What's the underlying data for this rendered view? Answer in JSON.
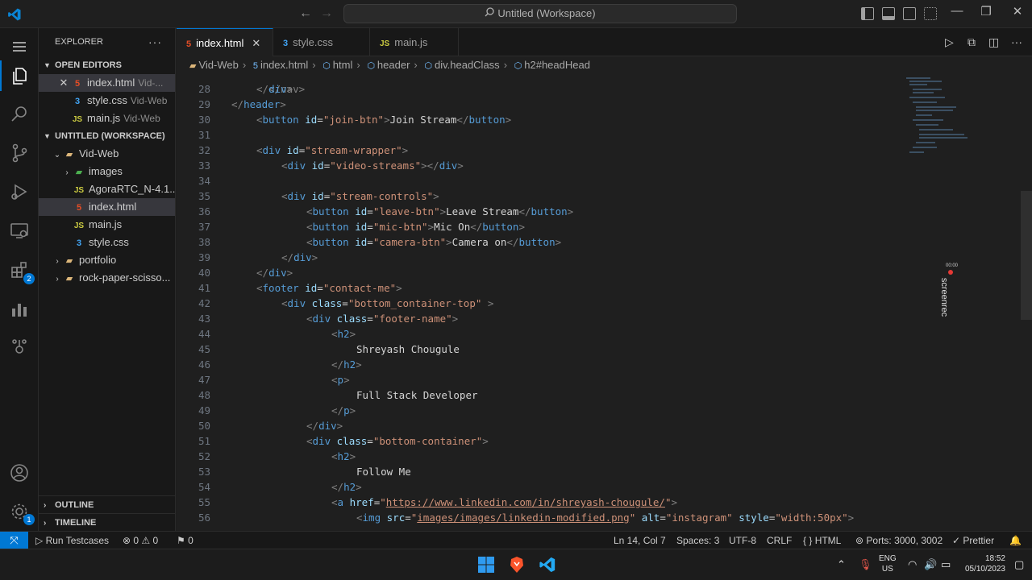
{
  "titlebar": {
    "search_text": "Untitled (Workspace)",
    "nav_back": "←",
    "nav_forward": "→",
    "minimize": "—",
    "restore": "❐",
    "close": "✕"
  },
  "sidebar": {
    "title": "EXPLORER",
    "more": "···",
    "open_editors_title": "OPEN EDITORS",
    "open_editors": [
      {
        "icon": "5",
        "name": "index.html",
        "desc": "Vid-...",
        "type": "html"
      },
      {
        "icon": "3",
        "name": "style.css",
        "desc": "Vid-Web",
        "type": "css"
      },
      {
        "icon": "JS",
        "name": "main.js",
        "desc": "Vid-Web",
        "type": "js"
      }
    ],
    "workspace_title": "UNTITLED (WORKSPACE)",
    "tree": [
      {
        "chev": "⌄",
        "icon": "▰",
        "name": "Vid-Web",
        "type": "folder",
        "indent": 16
      },
      {
        "chev": "›",
        "icon": "▰",
        "name": "images",
        "type": "img",
        "indent": 28
      },
      {
        "chev": "",
        "icon": "JS",
        "name": "AgoraRTC_N-4.1....",
        "type": "js",
        "indent": 28
      },
      {
        "chev": "",
        "icon": "5",
        "name": "index.html",
        "type": "html",
        "indent": 28
      },
      {
        "chev": "",
        "icon": "JS",
        "name": "main.js",
        "type": "js",
        "indent": 28
      },
      {
        "chev": "",
        "icon": "3",
        "name": "style.css",
        "type": "css",
        "indent": 28
      },
      {
        "chev": "›",
        "icon": "▰",
        "name": "portfolio",
        "type": "folder",
        "indent": 16
      },
      {
        "chev": "›",
        "icon": "▰",
        "name": "rock-paper-scisso...",
        "type": "folder",
        "indent": 16
      }
    ],
    "outline_title": "OUTLINE",
    "timeline_title": "TIMELINE"
  },
  "tabs": [
    {
      "icon": "5",
      "name": "index.html",
      "type": "html",
      "close": "✕"
    },
    {
      "icon": "3",
      "name": "style.css",
      "type": "css"
    },
    {
      "icon": "JS",
      "name": "main.js",
      "type": "js"
    }
  ],
  "breadcrumb": {
    "items": [
      "Vid-Web",
      "index.html",
      "html",
      "header",
      "div.headClass",
      "h2#headHead"
    ]
  },
  "editor": {
    "partial_top": "</nav>",
    "lines": [
      {
        "n": 28,
        "indent": 1,
        "parts": [
          [
            "p",
            "</"
          ],
          [
            "t",
            "div"
          ],
          [
            "p",
            ">"
          ]
        ]
      },
      {
        "n": 29,
        "indent": 0,
        "parts": [
          [
            "p",
            "</"
          ],
          [
            "t",
            "header"
          ],
          [
            "p",
            ">"
          ]
        ]
      },
      {
        "n": 30,
        "indent": 1,
        "parts": [
          [
            "p",
            "<"
          ],
          [
            "t",
            "button"
          ],
          [
            "x",
            " "
          ],
          [
            "a",
            "id"
          ],
          [
            "x",
            "="
          ],
          [
            "s",
            "\"join-btn\""
          ],
          [
            "p",
            ">"
          ],
          [
            "x",
            "Join Stream"
          ],
          [
            "p",
            "</"
          ],
          [
            "t",
            "button"
          ],
          [
            "p",
            ">"
          ]
        ]
      },
      {
        "n": 31,
        "indent": 0,
        "parts": []
      },
      {
        "n": 32,
        "indent": 1,
        "parts": [
          [
            "p",
            "<"
          ],
          [
            "t",
            "div"
          ],
          [
            "x",
            " "
          ],
          [
            "a",
            "id"
          ],
          [
            "x",
            "="
          ],
          [
            "s",
            "\"stream-wrapper\""
          ],
          [
            "p",
            ">"
          ]
        ]
      },
      {
        "n": 33,
        "indent": 2,
        "parts": [
          [
            "p",
            "<"
          ],
          [
            "t",
            "div"
          ],
          [
            "x",
            " "
          ],
          [
            "a",
            "id"
          ],
          [
            "x",
            "="
          ],
          [
            "s",
            "\"video-streams\""
          ],
          [
            "p",
            "></"
          ],
          [
            "t",
            "div"
          ],
          [
            "p",
            ">"
          ]
        ]
      },
      {
        "n": 34,
        "indent": 0,
        "parts": []
      },
      {
        "n": 35,
        "indent": 2,
        "parts": [
          [
            "p",
            "<"
          ],
          [
            "t",
            "div"
          ],
          [
            "x",
            " "
          ],
          [
            "a",
            "id"
          ],
          [
            "x",
            "="
          ],
          [
            "s",
            "\"stream-controls\""
          ],
          [
            "p",
            ">"
          ]
        ]
      },
      {
        "n": 36,
        "indent": 3,
        "parts": [
          [
            "p",
            "<"
          ],
          [
            "t",
            "button"
          ],
          [
            "x",
            " "
          ],
          [
            "a",
            "id"
          ],
          [
            "x",
            "="
          ],
          [
            "s",
            "\"leave-btn\""
          ],
          [
            "p",
            ">"
          ],
          [
            "x",
            "Leave Stream"
          ],
          [
            "p",
            "</"
          ],
          [
            "t",
            "button"
          ],
          [
            "p",
            ">"
          ]
        ]
      },
      {
        "n": 37,
        "indent": 3,
        "parts": [
          [
            "p",
            "<"
          ],
          [
            "t",
            "button"
          ],
          [
            "x",
            " "
          ],
          [
            "a",
            "id"
          ],
          [
            "x",
            "="
          ],
          [
            "s",
            "\"mic-btn\""
          ],
          [
            "p",
            ">"
          ],
          [
            "x",
            "Mic On"
          ],
          [
            "p",
            "</"
          ],
          [
            "t",
            "button"
          ],
          [
            "p",
            ">"
          ]
        ]
      },
      {
        "n": 38,
        "indent": 3,
        "parts": [
          [
            "p",
            "<"
          ],
          [
            "t",
            "button"
          ],
          [
            "x",
            " "
          ],
          [
            "a",
            "id"
          ],
          [
            "x",
            "="
          ],
          [
            "s",
            "\"camera-btn\""
          ],
          [
            "p",
            ">"
          ],
          [
            "x",
            "Camera on"
          ],
          [
            "p",
            "</"
          ],
          [
            "t",
            "button"
          ],
          [
            "p",
            ">"
          ]
        ]
      },
      {
        "n": 39,
        "indent": 2,
        "parts": [
          [
            "p",
            "</"
          ],
          [
            "t",
            "div"
          ],
          [
            "p",
            ">"
          ]
        ]
      },
      {
        "n": 40,
        "indent": 1,
        "parts": [
          [
            "p",
            "</"
          ],
          [
            "t",
            "div"
          ],
          [
            "p",
            ">"
          ]
        ]
      },
      {
        "n": 41,
        "indent": 1,
        "parts": [
          [
            "p",
            "<"
          ],
          [
            "t",
            "footer"
          ],
          [
            "x",
            " "
          ],
          [
            "a",
            "id"
          ],
          [
            "x",
            "="
          ],
          [
            "s",
            "\"contact-me\""
          ],
          [
            "p",
            ">"
          ]
        ]
      },
      {
        "n": 42,
        "indent": 2,
        "parts": [
          [
            "p",
            "<"
          ],
          [
            "t",
            "div"
          ],
          [
            "x",
            " "
          ],
          [
            "a",
            "class"
          ],
          [
            "x",
            "="
          ],
          [
            "s",
            "\"bottom_container-top\""
          ],
          [
            "x",
            " "
          ],
          [
            "p",
            ">"
          ]
        ]
      },
      {
        "n": 43,
        "indent": 3,
        "parts": [
          [
            "p",
            "<"
          ],
          [
            "t",
            "div"
          ],
          [
            "x",
            " "
          ],
          [
            "a",
            "class"
          ],
          [
            "x",
            "="
          ],
          [
            "s",
            "\"footer-name\""
          ],
          [
            "p",
            ">"
          ]
        ]
      },
      {
        "n": 44,
        "indent": 4,
        "parts": [
          [
            "p",
            "<"
          ],
          [
            "t",
            "h2"
          ],
          [
            "p",
            ">"
          ]
        ]
      },
      {
        "n": 45,
        "indent": 5,
        "parts": [
          [
            "x",
            "Shreyash Chougule"
          ]
        ]
      },
      {
        "n": 46,
        "indent": 4,
        "parts": [
          [
            "p",
            "</"
          ],
          [
            "t",
            "h2"
          ],
          [
            "p",
            ">"
          ]
        ]
      },
      {
        "n": 47,
        "indent": 4,
        "parts": [
          [
            "p",
            "<"
          ],
          [
            "t",
            "p"
          ],
          [
            "p",
            ">"
          ]
        ]
      },
      {
        "n": 48,
        "indent": 5,
        "parts": [
          [
            "x",
            "Full Stack Developer"
          ]
        ]
      },
      {
        "n": 49,
        "indent": 4,
        "parts": [
          [
            "p",
            "</"
          ],
          [
            "t",
            "p"
          ],
          [
            "p",
            ">"
          ]
        ]
      },
      {
        "n": 50,
        "indent": 3,
        "parts": [
          [
            "p",
            "</"
          ],
          [
            "t",
            "div"
          ],
          [
            "p",
            ">"
          ]
        ]
      },
      {
        "n": 51,
        "indent": 3,
        "parts": [
          [
            "p",
            "<"
          ],
          [
            "t",
            "div"
          ],
          [
            "x",
            " "
          ],
          [
            "a",
            "class"
          ],
          [
            "x",
            "="
          ],
          [
            "s",
            "\"bottom-container\""
          ],
          [
            "p",
            ">"
          ]
        ]
      },
      {
        "n": 52,
        "indent": 4,
        "parts": [
          [
            "p",
            "<"
          ],
          [
            "t",
            "h2"
          ],
          [
            "p",
            ">"
          ]
        ]
      },
      {
        "n": 53,
        "indent": 5,
        "parts": [
          [
            "x",
            "Follow Me"
          ]
        ]
      },
      {
        "n": 54,
        "indent": 4,
        "parts": [
          [
            "p",
            "</"
          ],
          [
            "t",
            "h2"
          ],
          [
            "p",
            ">"
          ]
        ]
      },
      {
        "n": 55,
        "indent": 4,
        "parts": [
          [
            "p",
            "<"
          ],
          [
            "t",
            "a"
          ],
          [
            "x",
            " "
          ],
          [
            "a",
            "href"
          ],
          [
            "x",
            "="
          ],
          [
            "s",
            "\""
          ],
          [
            "l",
            "https://www.linkedin.com/in/shreyash-chougule/"
          ],
          [
            "s",
            "\""
          ],
          [
            "p",
            ">"
          ]
        ]
      },
      {
        "n": 56,
        "indent": 5,
        "parts": [
          [
            "p",
            "<"
          ],
          [
            "t",
            "img"
          ],
          [
            "x",
            " "
          ],
          [
            "a",
            "src"
          ],
          [
            "x",
            "="
          ],
          [
            "s",
            "\""
          ],
          [
            "l",
            "images/images/linkedin-modified.png"
          ],
          [
            "s",
            "\""
          ],
          [
            "x",
            " "
          ],
          [
            "a",
            "alt"
          ],
          [
            "x",
            "="
          ],
          [
            "s",
            "\"instagram\""
          ],
          [
            "x",
            " "
          ],
          [
            "a",
            "style"
          ],
          [
            "x",
            "="
          ],
          [
            "s",
            "\"width:50px\""
          ],
          [
            "p",
            ">"
          ]
        ]
      }
    ]
  },
  "screenrec": {
    "label": "screenrec",
    "time": "00:00"
  },
  "statusbar": {
    "remote": "⤧",
    "run_testcases": "Run Testcases",
    "problems": "⊗ 0 ⚠ 0",
    "ports_warn": "⚑ 0",
    "position": "Ln 14, Col 7",
    "spaces": "Spaces: 3",
    "encoding": "UTF-8",
    "eol": "CRLF",
    "language": "HTML",
    "ports": "Ports: 3000, 3002",
    "prettier": "Prettier"
  },
  "taskbar": {
    "lang_top": "ENG",
    "lang_bottom": "US",
    "time": "18:52",
    "date": "05/10/2023"
  },
  "colors": {
    "accent": "#0078d4",
    "editor_bg": "#1f1f1f",
    "tag": "#569cd6",
    "attr": "#9cdcfe",
    "string": "#ce9178"
  }
}
